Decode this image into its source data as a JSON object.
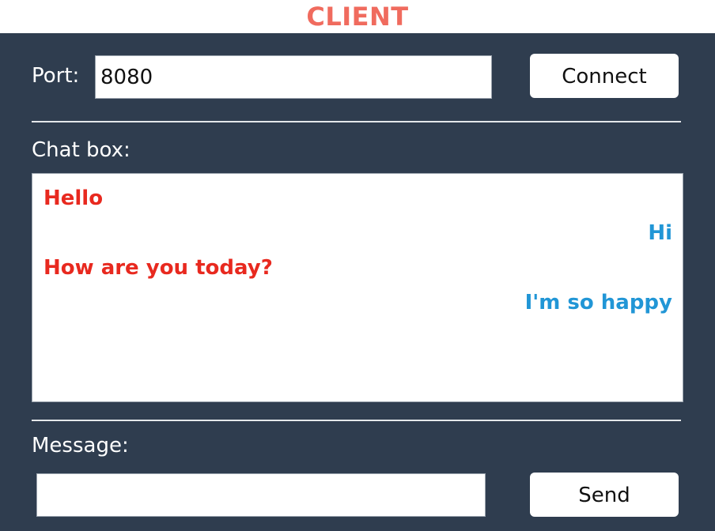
{
  "app": {
    "title": "CLIENT"
  },
  "colors": {
    "title": "#f06b5e",
    "panel_background": "#2f3d4f",
    "own_message": "#e8291f",
    "peer_message": "#2196d6"
  },
  "connection": {
    "port_label": "Port:",
    "port_value": "8080",
    "connect_label": "Connect"
  },
  "chat": {
    "label": "Chat box:",
    "messages": [
      {
        "text": "Hello",
        "align": "left"
      },
      {
        "text": "Hi",
        "align": "right"
      },
      {
        "text": "How are you today?",
        "align": "left"
      },
      {
        "text": "I'm so happy",
        "align": "right"
      }
    ]
  },
  "composer": {
    "label": "Message:",
    "value": "",
    "send_label": "Send"
  }
}
